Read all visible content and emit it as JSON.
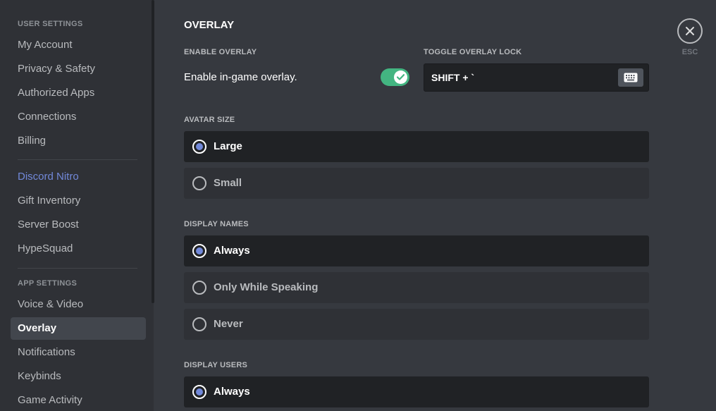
{
  "sidebar": {
    "user_settings_header": "USER SETTINGS",
    "user_items": [
      "My Account",
      "Privacy & Safety",
      "Authorized Apps",
      "Connections",
      "Billing"
    ],
    "nitro_items": [
      "Discord Nitro",
      "Gift Inventory",
      "Server Boost",
      "HypeSquad"
    ],
    "app_settings_header": "APP SETTINGS",
    "app_items": [
      "Voice & Video",
      "Overlay",
      "Notifications",
      "Keybinds",
      "Game Activity"
    ],
    "selected": "Overlay"
  },
  "main": {
    "title": "OVERLAY",
    "enable_overlay_label": "ENABLE OVERLAY",
    "enable_overlay_text": "Enable in-game overlay.",
    "enable_overlay_on": true,
    "toggle_lock_label": "TOGGLE OVERLAY LOCK",
    "toggle_lock_value": "SHIFT + `",
    "avatar_size": {
      "label": "AVATAR SIZE",
      "options": [
        "Large",
        "Small"
      ],
      "selected": "Large"
    },
    "display_names": {
      "label": "DISPLAY NAMES",
      "options": [
        "Always",
        "Only While Speaking",
        "Never"
      ],
      "selected": "Always"
    },
    "display_users": {
      "label": "DISPLAY USERS",
      "options": [
        "Always"
      ],
      "selected": "Always"
    }
  },
  "close": {
    "esc_label": "ESC"
  },
  "colors": {
    "accent": "#7289da",
    "toggle_on": "#43b581",
    "background": "#36393f",
    "sidebar": "#2f3136"
  }
}
